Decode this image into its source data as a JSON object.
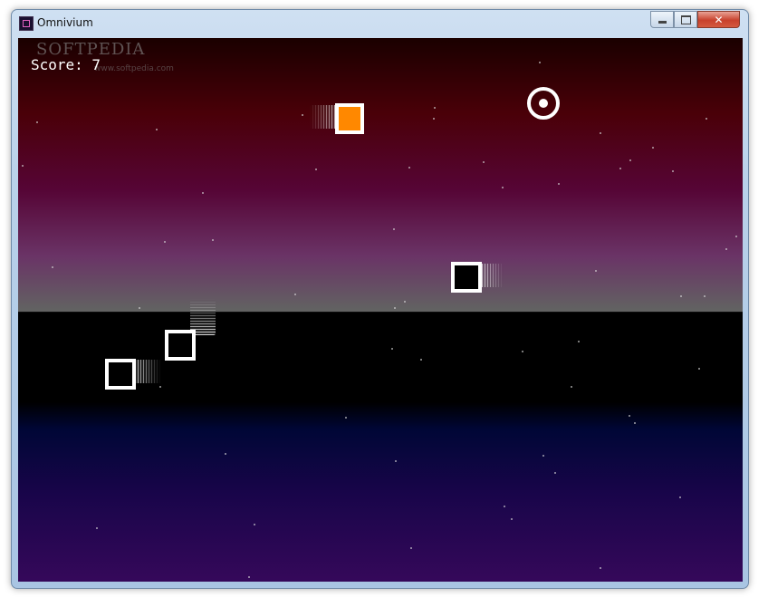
{
  "window": {
    "title": "Omnivium",
    "controls": {
      "minimize": "minimize",
      "maximize": "maximize",
      "close": "✕"
    }
  },
  "watermark": {
    "brand": "SOFTPEDIA",
    "url": "www.softpedia.com"
  },
  "hud": {
    "score_text": "Score: 7"
  },
  "colors": {
    "sky_top": "#1a0000",
    "horizon_gray": "#626262",
    "ground_black": "#000000",
    "bottom_purple": "#35085a",
    "player_fill": "#ff8800",
    "block_outline": "#ffffff"
  },
  "entities": {
    "player": {
      "type": "orange-block"
    },
    "target": {
      "type": "ring-target"
    },
    "enemies": [
      {
        "type": "black-block"
      },
      {
        "type": "black-block"
      },
      {
        "type": "black-block"
      }
    ]
  }
}
